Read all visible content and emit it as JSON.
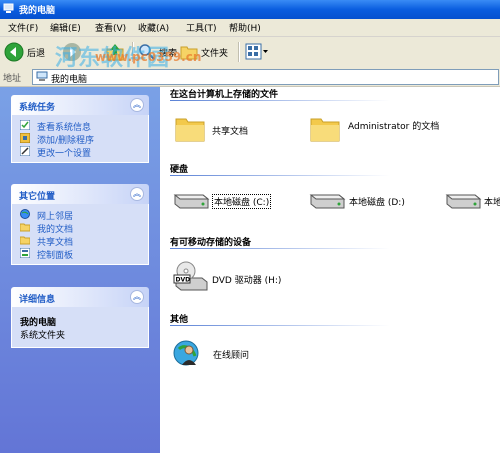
{
  "window": {
    "title": "我的电脑"
  },
  "menu": [
    "文件(F)",
    "编辑(E)",
    "查看(V)",
    "收藏(A)",
    "工具(T)",
    "帮助(H)"
  ],
  "toolbar": {
    "back": "后退",
    "search": "搜索",
    "folders": "文件夹"
  },
  "address": {
    "label": "地址",
    "value": "我的电脑"
  },
  "tasks": {
    "system": {
      "title": "系统任务",
      "items": [
        "查看系统信息",
        "添加/删除程序",
        "更改一个设置"
      ]
    },
    "other": {
      "title": "其它位置",
      "items": [
        "网上邻居",
        "我的文档",
        "共享文档",
        "控制面板"
      ]
    },
    "details": {
      "title": "详细信息",
      "name": "我的电脑",
      "desc": "系统文件夹"
    }
  },
  "groups": {
    "stored": {
      "title": "在这台计算机上存储的文件",
      "items": [
        "共享文档",
        "Administrator 的文档"
      ]
    },
    "disks": {
      "title": "硬盘",
      "items": [
        "本地磁盘 (C:)",
        "本地磁盘 (D:)",
        "本地"
      ]
    },
    "removable": {
      "title": "有可移动存储的设备",
      "items": [
        "DVD 驱动器 (H:)"
      ]
    },
    "other": {
      "title": "其他",
      "items": [
        "在线顾问"
      ]
    }
  },
  "watermark": {
    "text1": "河东软件园",
    "text2": "www.pc0359.cn"
  },
  "colors": {
    "titlebar": "#0a5ddf",
    "taskpane": "#7aa1e6",
    "link": "#215dc6"
  }
}
